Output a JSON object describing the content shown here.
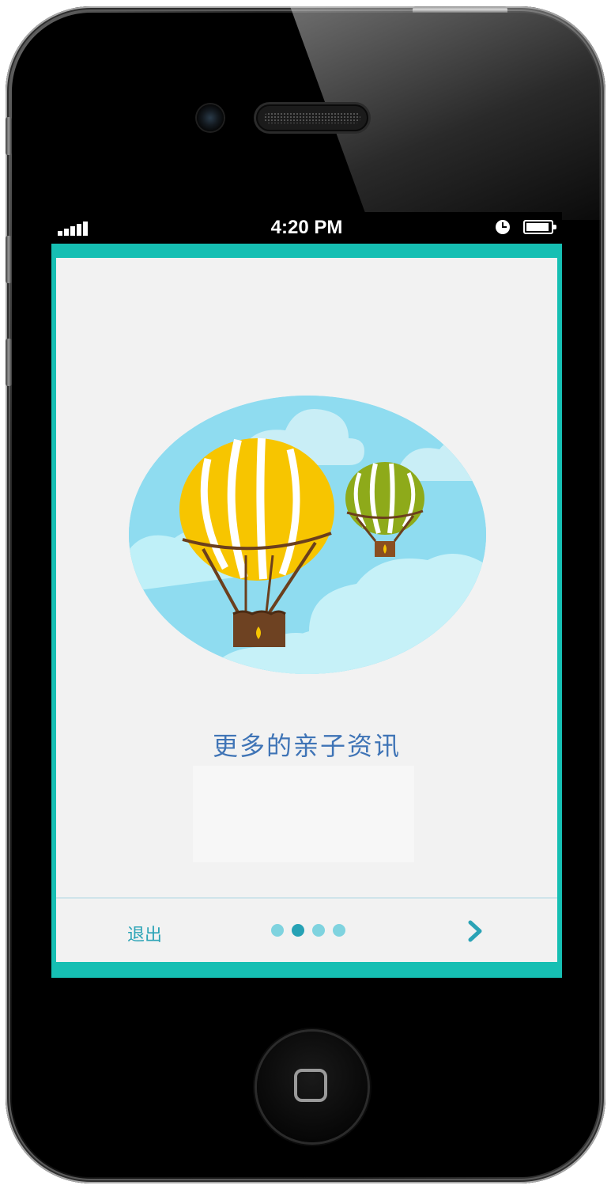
{
  "status_bar": {
    "time": "4:20 PM",
    "signal_icon": "signal-bars-icon",
    "clock_icon": "alarm-clock-icon",
    "battery_icon": "battery-icon"
  },
  "onboarding": {
    "caption": "更多的亲子资讯",
    "illustration": "hot-air-balloons-illustration",
    "exit_label": "退出",
    "next_icon": "chevron-right-icon",
    "page_count": 4,
    "active_page": 2
  },
  "colors": {
    "accent": "#16bfb3",
    "caption": "#3f74b6",
    "control": "#2aa3b6",
    "dot_active": "#26a2b5",
    "dot_inactive": "#7fd3df"
  }
}
